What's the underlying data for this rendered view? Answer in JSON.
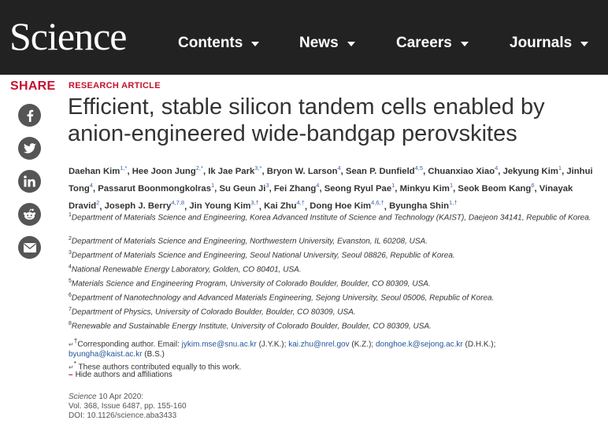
{
  "header": {
    "logo": "Science",
    "nav": [
      {
        "label": "Contents"
      },
      {
        "label": "News"
      },
      {
        "label": "Careers"
      },
      {
        "label": "Journals"
      }
    ]
  },
  "share": {
    "label": "SHARE",
    "buttons": [
      "facebook-icon",
      "twitter-icon",
      "linkedin-icon",
      "reddit-icon",
      "email-icon"
    ],
    "button_color": "#555555"
  },
  "article": {
    "kicker": "RESEARCH ARTICLE",
    "title": "Efficient, stable silicon tandem cells enabled by anion-engineered wide-bandgap perovskites",
    "authors": [
      {
        "name": "Daehan Kim",
        "sup": "1,*"
      },
      {
        "name": "Hee Joon Jung",
        "sup": "2,*"
      },
      {
        "name": "Ik Jae Park",
        "sup": "3,*"
      },
      {
        "name": "Bryon W. Larson",
        "sup": "4"
      },
      {
        "name": "Sean P. Dunfield",
        "sup": "4,5"
      },
      {
        "name": "Chuanxiao Xiao",
        "sup": "4"
      },
      {
        "name": "Jekyung Kim",
        "sup": "1"
      },
      {
        "name": "Jinhui Tong",
        "sup": "4"
      },
      {
        "name": "Passarut Boonmongkolras",
        "sup": "1"
      },
      {
        "name": "Su Geun Ji",
        "sup": "3"
      },
      {
        "name": "Fei Zhang",
        "sup": "4"
      },
      {
        "name": "Seong Ryul Pae",
        "sup": "1"
      },
      {
        "name": "Minkyu Kim",
        "sup": "1"
      },
      {
        "name": "Seok Beom Kang",
        "sup": "6"
      },
      {
        "name": "Vinayak Dravid",
        "sup": "2"
      },
      {
        "name": "Joseph J. Berry",
        "sup": "4,7,8"
      },
      {
        "name": "Jin Young Kim",
        "sup": "3,†"
      },
      {
        "name": "Kai Zhu",
        "sup": "4,†"
      },
      {
        "name": "Dong Hoe Kim",
        "sup": "4,6,†"
      },
      {
        "name": "Byungha Shin",
        "sup": "1,†"
      }
    ],
    "affiliations": [
      {
        "num": "1",
        "text": "Department of Materials Science and Engineering, Korea Advanced Institute of Science and Technology (KAIST), Daejeon 34141, Republic of Korea."
      },
      {
        "num": "2",
        "text": "Department of Materials Science and Engineering, Northwestern University, Evanston, IL 60208, USA."
      },
      {
        "num": "3",
        "text": "Department of Materials Science and Engineering, Seoul National University, Seoul 08826, Republic of Korea."
      },
      {
        "num": "4",
        "text": "National Renewable Energy Laboratory, Golden, CO 80401, USA."
      },
      {
        "num": "5",
        "text": "Materials Science and Engineering Program, University of Colorado Boulder, Boulder, CO 80309, USA."
      },
      {
        "num": "6",
        "text": "Department of Nanotechnology and Advanced Materials Engineering, Sejong University, Seoul 05006, Republic of Korea."
      },
      {
        "num": "7",
        "text": "Department of Physics, University of Colorado Boulder, Boulder, CO 80309, USA."
      },
      {
        "num": "8",
        "text": "Renewable and Sustainable Energy Institute, University of Colorado Boulder, Boulder, CO 80309, USA."
      }
    ],
    "corresponding": {
      "prefix": "↵",
      "marker": "†",
      "lead": "Corresponding author. Email: ",
      "contacts": [
        {
          "email": "jykim.mse@snu.ac.kr",
          "initials": " (J.Y.K.); "
        },
        {
          "email": "kai.zhu@nrel.gov",
          "initials": " (K.Z.); "
        },
        {
          "email": "donghoe.k@sejong.ac.kr",
          "initials": " (D.H.K.); "
        },
        {
          "email": "byungha@kaist.ac.kr",
          "initials": " (B.S.)"
        }
      ]
    },
    "equal_contrib": {
      "prefix": "↵",
      "marker": "*",
      "text": " These authors contributed equally to this work."
    },
    "hide_toggle": {
      "symbol": "–",
      "label": "Hide authors and affiliations"
    },
    "citation": {
      "journal": "Science",
      "date": " 10 Apr 2020:",
      "volume": "Vol. 368, Issue 6487, pp. 155-160",
      "doi": "DOI: 10.1126/science.aba3433"
    }
  },
  "colors": {
    "accent": "#c41230",
    "header_bg": "#222222",
    "link": "#24569a"
  }
}
